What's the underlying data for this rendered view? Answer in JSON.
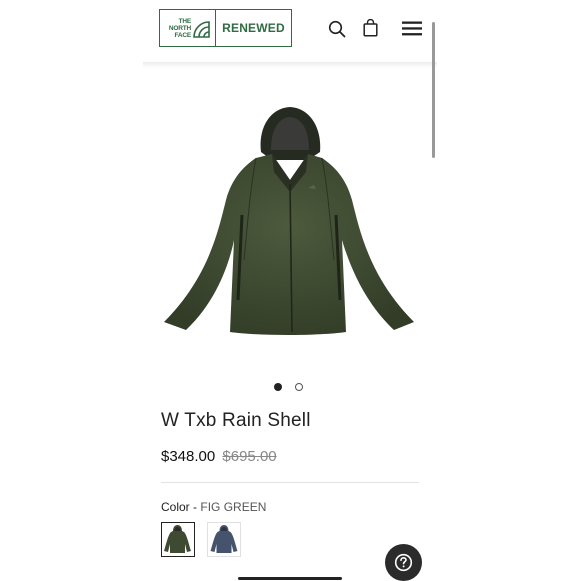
{
  "header": {
    "logo": {
      "brand_lines": [
        "THE",
        "NORTH",
        "FACE"
      ],
      "program": "RENEWED"
    },
    "icons": [
      "search-icon",
      "bag-icon",
      "menu-icon"
    ]
  },
  "carousel": {
    "total_slides": 2,
    "active_slide": 1
  },
  "product": {
    "name": "W Txb Rain Shell",
    "price": "$348.00",
    "original_price": "$695.00",
    "color_label": "Color -",
    "color_value": "FIG GREEN",
    "swatches": [
      {
        "name": "FIG GREEN",
        "hex": "#3f4a33",
        "selected": true
      },
      {
        "name": "BLUE",
        "hex": "#45536c",
        "selected": false
      }
    ]
  },
  "colors": {
    "brand_green": "#2f6b43",
    "jacket_green": "#3f4a33",
    "text": "#222222",
    "muted": "#888888"
  },
  "help": {
    "icon": "help-icon"
  }
}
